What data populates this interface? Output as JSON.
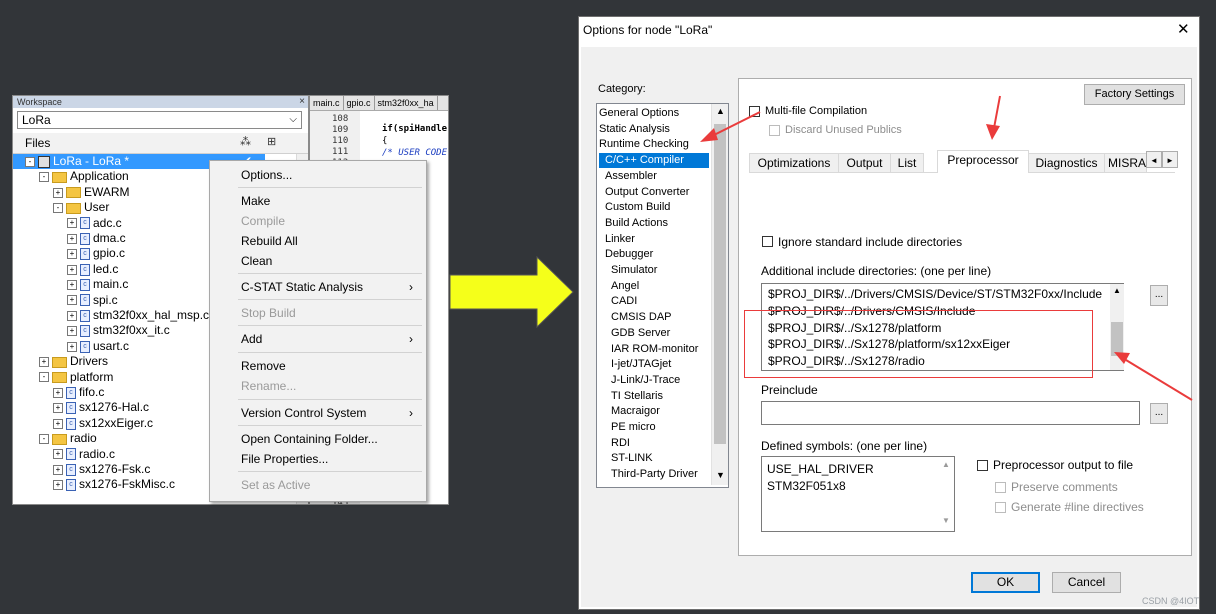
{
  "workspace": {
    "title": "Workspace",
    "close_glyph": "×",
    "combo_value": "LoRa",
    "files_header": "Files",
    "col_icon1": "⁂",
    "col_icon2": "⊞",
    "root_check": "✔",
    "tree": [
      {
        "label": "LoRa - LoRa *",
        "kind": "project",
        "indent": 0,
        "pm": "-"
      },
      {
        "label": "Application",
        "kind": "folder",
        "indent": 1,
        "pm": "-"
      },
      {
        "label": "EWARM",
        "kind": "folder",
        "indent": 2,
        "pm": "+"
      },
      {
        "label": "User",
        "kind": "folder",
        "indent": 2,
        "pm": "-"
      },
      {
        "label": "adc.c",
        "kind": "file",
        "indent": 3,
        "pm": "+"
      },
      {
        "label": "dma.c",
        "kind": "file",
        "indent": 3,
        "pm": "+"
      },
      {
        "label": "gpio.c",
        "kind": "file",
        "indent": 3,
        "pm": "+"
      },
      {
        "label": "led.c",
        "kind": "file",
        "indent": 3,
        "pm": "+"
      },
      {
        "label": "main.c",
        "kind": "file",
        "indent": 3,
        "pm": "+"
      },
      {
        "label": "spi.c",
        "kind": "file",
        "indent": 3,
        "pm": "+"
      },
      {
        "label": "stm32f0xx_hal_msp.c",
        "kind": "file",
        "indent": 3,
        "pm": "+"
      },
      {
        "label": "stm32f0xx_it.c",
        "kind": "file",
        "indent": 3,
        "pm": "+"
      },
      {
        "label": "usart.c",
        "kind": "file",
        "indent": 3,
        "pm": "+"
      },
      {
        "label": "Drivers",
        "kind": "folder",
        "indent": 1,
        "pm": "+"
      },
      {
        "label": "platform",
        "kind": "folder",
        "indent": 1,
        "pm": "-"
      },
      {
        "label": "fifo.c",
        "kind": "file",
        "indent": 2,
        "pm": "+"
      },
      {
        "label": "sx1276-Hal.c",
        "kind": "file",
        "indent": 2,
        "pm": "+"
      },
      {
        "label": "sx12xxEiger.c",
        "kind": "file",
        "indent": 2,
        "pm": "+"
      },
      {
        "label": "radio",
        "kind": "folder",
        "indent": 1,
        "pm": "-"
      },
      {
        "label": "radio.c",
        "kind": "file",
        "indent": 2,
        "pm": "+"
      },
      {
        "label": "sx1276-Fsk.c",
        "kind": "file",
        "indent": 2,
        "pm": "+"
      },
      {
        "label": "sx1276-FskMisc.c",
        "kind": "file",
        "indent": 2,
        "pm": "+"
      }
    ]
  },
  "editor": {
    "tabs": [
      "main.c",
      "gpio.c",
      "stm32f0xx_ha"
    ],
    "line_numbers": [
      "108",
      "109",
      "110",
      "111",
      "112",
      "143"
    ],
    "code": [
      "if(spiHandle",
      "{",
      "/* USER CODE"
    ]
  },
  "context_menu": {
    "items": [
      {
        "label": "Options...",
        "disabled": false,
        "submenu": false
      },
      {
        "label": "Make",
        "disabled": false,
        "submenu": false
      },
      {
        "label": "Compile",
        "disabled": true,
        "submenu": false
      },
      {
        "label": "Rebuild All",
        "disabled": false,
        "submenu": false
      },
      {
        "label": "Clean",
        "disabled": false,
        "submenu": false
      },
      {
        "label": "C-STAT Static Analysis",
        "disabled": false,
        "submenu": true
      },
      {
        "label": "Stop Build",
        "disabled": true,
        "submenu": false
      },
      {
        "label": "Add",
        "disabled": false,
        "submenu": true
      },
      {
        "label": "Remove",
        "disabled": false,
        "submenu": false
      },
      {
        "label": "Rename...",
        "disabled": true,
        "submenu": false
      },
      {
        "label": "Version Control System",
        "disabled": false,
        "submenu": true
      },
      {
        "label": "Open Containing Folder...",
        "disabled": false,
        "submenu": false
      },
      {
        "label": "File Properties...",
        "disabled": false,
        "submenu": false
      },
      {
        "label": "Set as Active",
        "disabled": true,
        "submenu": false
      }
    ],
    "submenu_glyph": "›"
  },
  "dialog": {
    "title": "Options for node \"LoRa\"",
    "close_glyph": "✕",
    "category_label": "Category:",
    "categories": [
      {
        "label": "General Options",
        "sub": false
      },
      {
        "label": "Static Analysis",
        "sub": false
      },
      {
        "label": "Runtime Checking",
        "sub": false
      },
      {
        "label": "C/C++ Compiler",
        "sub": true,
        "selected": true
      },
      {
        "label": "Assembler",
        "sub": true
      },
      {
        "label": "Output Converter",
        "sub": true
      },
      {
        "label": "Custom Build",
        "sub": true
      },
      {
        "label": "Build Actions",
        "sub": true
      },
      {
        "label": "Linker",
        "sub": true
      },
      {
        "label": "Debugger",
        "sub": true
      },
      {
        "label": "Simulator",
        "sub": true,
        "deep": true
      },
      {
        "label": "Angel",
        "sub": true,
        "deep": true
      },
      {
        "label": "CADI",
        "sub": true,
        "deep": true
      },
      {
        "label": "CMSIS DAP",
        "sub": true,
        "deep": true
      },
      {
        "label": "GDB Server",
        "sub": true,
        "deep": true
      },
      {
        "label": "IAR ROM-monitor",
        "sub": true,
        "deep": true
      },
      {
        "label": "I-jet/JTAGjet",
        "sub": true,
        "deep": true
      },
      {
        "label": "J-Link/J-Trace",
        "sub": true,
        "deep": true
      },
      {
        "label": "TI Stellaris",
        "sub": true,
        "deep": true
      },
      {
        "label": "Macraigor",
        "sub": true,
        "deep": true
      },
      {
        "label": "PE micro",
        "sub": true,
        "deep": true
      },
      {
        "label": "RDI",
        "sub": true,
        "deep": true
      },
      {
        "label": "ST-LINK",
        "sub": true,
        "deep": true
      },
      {
        "label": "Third-Party Driver",
        "sub": true,
        "deep": true
      }
    ],
    "scroll_up": "▲",
    "scroll_down": "▼",
    "factory_settings": "Factory Settings",
    "multifile": "Multi-file Compilation",
    "discard_unused": "Discard Unused Publics",
    "tabs": [
      "Optimizations",
      "Output",
      "List",
      "Preprocessor",
      "Diagnostics",
      "MISRA"
    ],
    "active_tab": "Preprocessor",
    "tab_left": "◄",
    "tab_right": "►",
    "ignore_std": "Ignore standard include directories",
    "include_label": "Additional include directories: (one per line)",
    "include_dirs": [
      "$PROJ_DIR$/../Drivers/CMSIS/Device/ST/STM32F0xx/Include",
      "$PROJ_DIR$/../Drivers/CMSIS/Include",
      "$PROJ_DIR$/../Sx1278/platform",
      "$PROJ_DIR$/../Sx1278/platform/sx12xxEiger",
      "$PROJ_DIR$/../Sx1278/radio"
    ],
    "browse_glyph": "...",
    "preinclude_label": "Preinclude",
    "preinclude_value": "",
    "defined_label": "Defined symbols: (one per line)",
    "defined_symbols": [
      "USE_HAL_DRIVER",
      "STM32F051x8"
    ],
    "pp_output": "Preprocessor output to file",
    "preserve_comments": "Preserve comments",
    "generate_line": "Generate #line directives",
    "ok": "OK",
    "cancel": "Cancel"
  },
  "watermark": "CSDN @4IOT",
  "colors": {
    "selection": "#0078d7",
    "annotation": "#ea3b3b",
    "arrow": "#f5ff1a"
  }
}
